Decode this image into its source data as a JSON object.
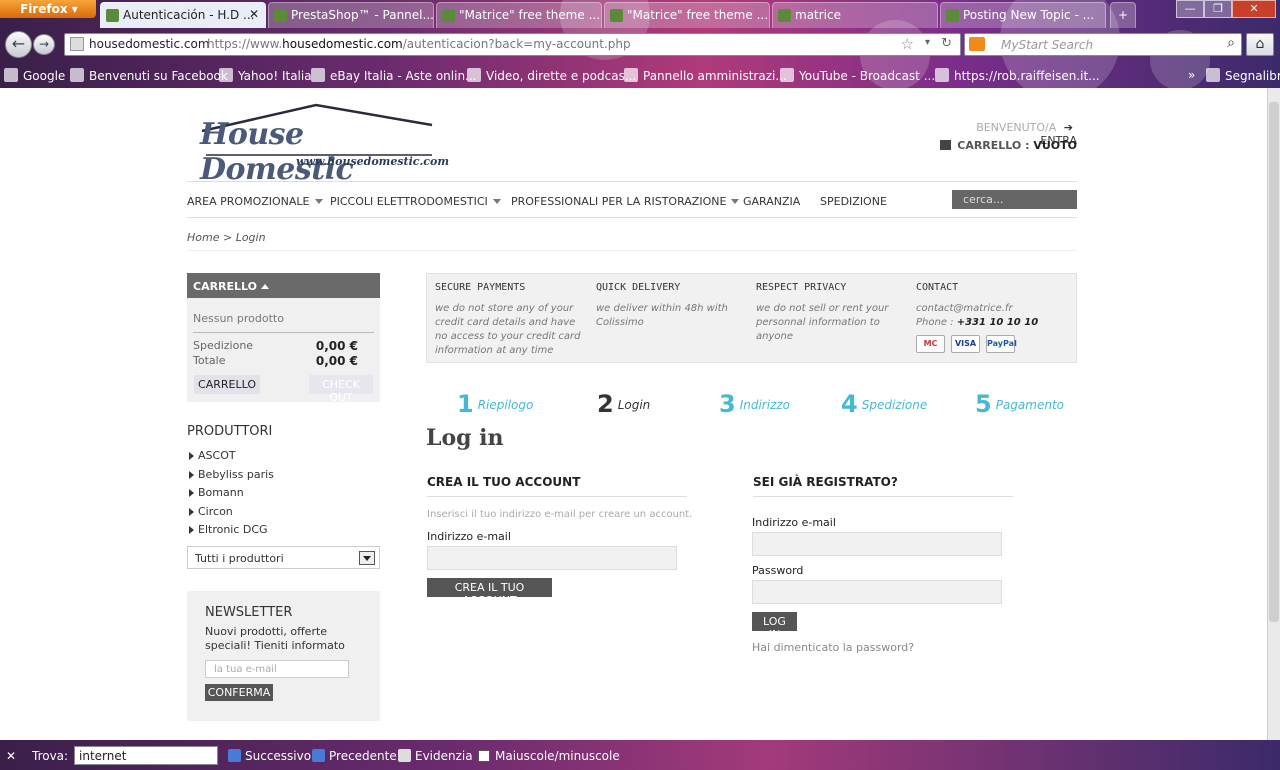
{
  "browser": {
    "menu_label": "Firefox",
    "tabs": [
      {
        "label": "Autenticación - H.D ..."
      },
      {
        "label": "PrestaShop™ - Pannel..."
      },
      {
        "label": "\"Matrice\" free theme ..."
      },
      {
        "label": "\"Matrice\" free theme ..."
      },
      {
        "label": "matrice"
      },
      {
        "label": "Posting New Topic - ..."
      }
    ],
    "site_label": "housedomestic.com",
    "url_prefix": "https://www.",
    "url_domain": "housedomestic.com",
    "url_path": "/autenticacion?back=my-account.php",
    "search_placeholder": "MyStart Search",
    "bookmarks": [
      {
        "label": "Google"
      },
      {
        "label": "Benvenuti su Facebook"
      },
      {
        "label": "Yahoo! Italia"
      },
      {
        "label": "eBay Italia - Aste onlin..."
      },
      {
        "label": "Video, dirette e podcas..."
      },
      {
        "label": "Pannello amministrazi..."
      },
      {
        "label": "YouTube - Broadcast ..."
      },
      {
        "label": "https://rob.raiffeisen.it..."
      }
    ],
    "bookmarks_folder": "Segnalibri"
  },
  "site": {
    "logo_title": "House Domestic",
    "logo_url": "www.housedomestic.com",
    "welcome": "BENVENUTO/A",
    "login_link": "ENTRA",
    "cart_label": "CARRELLO :",
    "cart_status": "VUOTO",
    "menu": [
      {
        "label": "AREA PROMOZIONALE",
        "dropdown": true
      },
      {
        "label": "PICCOLI ELETTRODOMESTICI",
        "dropdown": true
      },
      {
        "label": "PROFESSIONALI PER LA RISTORAZIONE",
        "dropdown": true
      },
      {
        "label": "GARANZIA",
        "dropdown": false
      },
      {
        "label": "SPEDIZIONE",
        "dropdown": false
      }
    ],
    "search_placeholder": "cerca...",
    "breadcrumb": "Home > Login"
  },
  "cart_block": {
    "title": "CARRELLO",
    "empty_text": "Nessun prodotto",
    "shipping_label": "Spedizione",
    "shipping_value": "0,00 €",
    "total_label": "Totale",
    "total_value": "0,00 €",
    "cart_button": "CARRELLO",
    "checkout_button": "CHECK OUT"
  },
  "producers": {
    "title": "PRODUTTORI",
    "items": [
      "ASCOT",
      "Bebyliss paris",
      "Bomann",
      "Circon",
      "Eltronic DCG"
    ],
    "select_value": "Tutti i produttori"
  },
  "newsletter": {
    "title": "NEWSLETTER",
    "description": "Nuovi prodotti, offerte speciali! Tieniti informato",
    "placeholder": "la tua e-mail",
    "button": "CONFERMA"
  },
  "info_bar": [
    {
      "title": "SECURE PAYMENTS",
      "text": "we do not store any of your credit card details and have no access to your credit card information at any time"
    },
    {
      "title": "QUICK DELIVERY",
      "text": "we deliver within 48h with Colissimo"
    },
    {
      "title": "RESPECT PRIVACY",
      "text": "we do not sell or rent your personnal information to anyone"
    },
    {
      "title": "CONTACT",
      "email": "contact@matrice.fr",
      "phone_label": "Phone :",
      "phone": "+331 10 10 10",
      "cards": [
        "MC",
        "VISA",
        "PayPal"
      ]
    }
  ],
  "steps": [
    {
      "num": "1",
      "label": "Riepilogo"
    },
    {
      "num": "2",
      "label": "Login"
    },
    {
      "num": "3",
      "label": "Indirizzo"
    },
    {
      "num": "4",
      "label": "Spedizione"
    },
    {
      "num": "5",
      "label": "Pagamento"
    }
  ],
  "login": {
    "heading": "Log in",
    "create_title": "CREA IL TUO ACCOUNT",
    "create_hint": "Inserisci il tuo indirizzo e-mail per creare un account.",
    "create_email_label": "Indirizzo e-mail",
    "create_button": "CREA IL TUO ACCOUNT",
    "registered_title": "SEI GIÀ REGISTRATO?",
    "email_label": "Indirizzo e-mail",
    "password_label": "Password",
    "login_button": "LOG IN",
    "forgot_link": "Hai dimenticato la password?"
  },
  "findbar": {
    "label": "Trova:",
    "value": "internet",
    "next": "Successivo",
    "prev": "Precedente",
    "highlight": "Evidenzia",
    "match_case": "Maiuscole/minuscole"
  }
}
